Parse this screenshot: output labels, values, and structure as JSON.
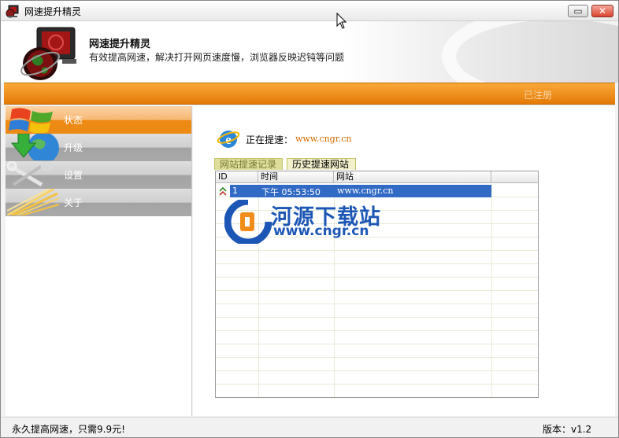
{
  "window": {
    "title": "网速提升精灵",
    "minimize_glyph": "▭",
    "close_glyph": "✕"
  },
  "banner": {
    "title": "网速提升精灵",
    "subtitle": "有效提高网速，解决打开网页速度慢，浏览器反映迟钝等问题"
  },
  "toolbar": {
    "link_label": "已注册"
  },
  "sidebar": {
    "items": [
      {
        "label": "状态",
        "icon": "windows-logo-icon",
        "active": true
      },
      {
        "label": "升级",
        "icon": "globe-download-icon",
        "active": false
      },
      {
        "label": "设置",
        "icon": "tools-icon",
        "active": false
      },
      {
        "label": "关于",
        "icon": "light-rays-icon",
        "active": false
      }
    ]
  },
  "main": {
    "status_label": "正在提速：",
    "status_url": "www.cngr.cn",
    "tabs": [
      {
        "label": "网站提速记录",
        "active": false
      },
      {
        "label": "历史提速网站",
        "active": true
      }
    ],
    "table": {
      "headers": [
        "ID",
        "时间",
        "网站",
        ""
      ],
      "rows": [
        {
          "id": "1",
          "time": "下午 05:53:50",
          "site": "www.cngr.cn",
          "icon": "double-up-arrow-icon"
        }
      ]
    }
  },
  "watermark": {
    "name": "河源下载站",
    "url": "www.cngr.cn"
  },
  "statusbar": {
    "left_text": "永久提高网速，只需9.9元!",
    "version_text": "版本：v1.2"
  },
  "colors": {
    "accent_orange": "#ec8a14",
    "selection_blue": "#316ac5",
    "url_orange": "#d56b00",
    "watermark_blue": "#1d57b6"
  }
}
